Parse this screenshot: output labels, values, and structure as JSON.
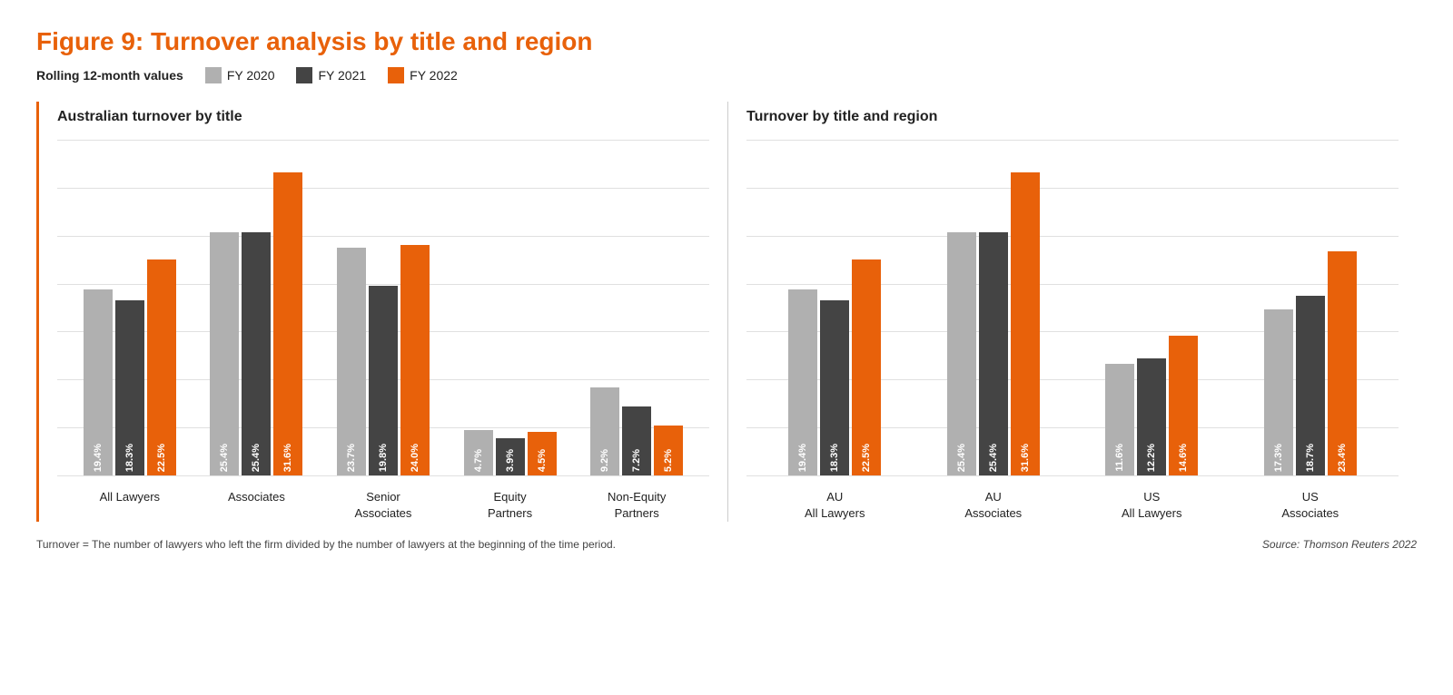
{
  "title": {
    "prefix": "Figure 9: ",
    "highlight": "Turnover analysis by title and region"
  },
  "legend": {
    "rolling_label": "Rolling 12-month values",
    "items": [
      {
        "label": "FY 2020",
        "color": "#b0b0b0"
      },
      {
        "label": "FY 2021",
        "color": "#444444"
      },
      {
        "label": "FY 2022",
        "color": "#e8610a"
      }
    ]
  },
  "chart_left": {
    "title": "Australian turnover by title",
    "max_value": 35,
    "groups": [
      {
        "label": "All Lawyers",
        "bars": [
          {
            "fy": "FY 2020",
            "value": 19.4,
            "label": "19.4%",
            "color": "#b0b0b0"
          },
          {
            "fy": "FY 2021",
            "value": 18.3,
            "label": "18.3%",
            "color": "#444444"
          },
          {
            "fy": "FY 2022",
            "value": 22.5,
            "label": "22.5%",
            "color": "#e8610a"
          }
        ]
      },
      {
        "label": "Associates",
        "bars": [
          {
            "fy": "FY 2020",
            "value": 25.4,
            "label": "25.4%",
            "color": "#b0b0b0"
          },
          {
            "fy": "FY 2021",
            "value": 25.4,
            "label": "25.4%",
            "color": "#444444"
          },
          {
            "fy": "FY 2022",
            "value": 31.6,
            "label": "31.6%",
            "color": "#e8610a"
          }
        ]
      },
      {
        "label": "Senior\nAssociates",
        "bars": [
          {
            "fy": "FY 2020",
            "value": 23.7,
            "label": "23.7%",
            "color": "#b0b0b0"
          },
          {
            "fy": "FY 2021",
            "value": 19.8,
            "label": "19.8%",
            "color": "#444444"
          },
          {
            "fy": "FY 2022",
            "value": 24.0,
            "label": "24.0%",
            "color": "#e8610a"
          }
        ]
      },
      {
        "label": "Equity\nPartners",
        "bars": [
          {
            "fy": "FY 2020",
            "value": 4.7,
            "label": "4.7%",
            "color": "#b0b0b0"
          },
          {
            "fy": "FY 2021",
            "value": 3.9,
            "label": "3.9%",
            "color": "#444444"
          },
          {
            "fy": "FY 2022",
            "value": 4.5,
            "label": "4.5%",
            "color": "#e8610a"
          }
        ]
      },
      {
        "label": "Non-Equity\nPartners",
        "bars": [
          {
            "fy": "FY 2020",
            "value": 9.2,
            "label": "9.2%",
            "color": "#b0b0b0"
          },
          {
            "fy": "FY 2021",
            "value": 7.2,
            "label": "7.2%",
            "color": "#444444"
          },
          {
            "fy": "FY 2022",
            "value": 5.2,
            "label": "5.2%",
            "color": "#e8610a"
          }
        ]
      }
    ]
  },
  "chart_right": {
    "title": "Turnover by title and region",
    "max_value": 35,
    "groups": [
      {
        "label": "AU\nAll Lawyers",
        "bars": [
          {
            "fy": "FY 2020",
            "value": 19.4,
            "label": "19.4%",
            "color": "#b0b0b0"
          },
          {
            "fy": "FY 2021",
            "value": 18.3,
            "label": "18.3%",
            "color": "#444444"
          },
          {
            "fy": "FY 2022",
            "value": 22.5,
            "label": "22.5%",
            "color": "#e8610a"
          }
        ]
      },
      {
        "label": "AU\nAssociates",
        "bars": [
          {
            "fy": "FY 2020",
            "value": 25.4,
            "label": "25.4%",
            "color": "#b0b0b0"
          },
          {
            "fy": "FY 2021",
            "value": 25.4,
            "label": "25.4%",
            "color": "#444444"
          },
          {
            "fy": "FY 2022",
            "value": 31.6,
            "label": "31.6%",
            "color": "#e8610a"
          }
        ]
      },
      {
        "label": "US\nAll Lawyers",
        "bars": [
          {
            "fy": "FY 2020",
            "value": 11.6,
            "label": "11.6%",
            "color": "#b0b0b0"
          },
          {
            "fy": "FY 2021",
            "value": 12.2,
            "label": "12.2%",
            "color": "#444444"
          },
          {
            "fy": "FY 2022",
            "value": 14.6,
            "label": "14.6%",
            "color": "#e8610a"
          }
        ]
      },
      {
        "label": "US\nAssociates",
        "bars": [
          {
            "fy": "FY 2020",
            "value": 17.3,
            "label": "17.3%",
            "color": "#b0b0b0"
          },
          {
            "fy": "FY 2021",
            "value": 18.7,
            "label": "18.7%",
            "color": "#444444"
          },
          {
            "fy": "FY 2022",
            "value": 23.4,
            "label": "23.4%",
            "color": "#e8610a"
          }
        ]
      }
    ]
  },
  "footnote": {
    "text": "Turnover = The number of lawyers who left the firm divided by the number of lawyers at the beginning of the time period.",
    "source": "Source: Thomson Reuters 2022"
  }
}
